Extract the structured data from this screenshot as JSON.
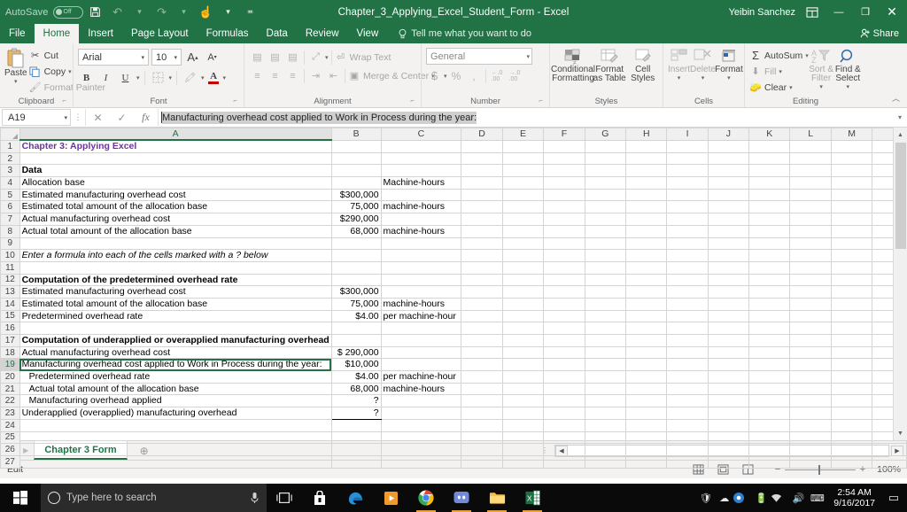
{
  "titlebar": {
    "autosave_label": "AutoSave",
    "autosave_state": "Off",
    "document_title": "Chapter_3_Applying_Excel_Student_Form  -  Excel",
    "user_name": "Yeibin Sanchez",
    "save_icon": "save-icon",
    "undo_icon": "undo-icon",
    "redo_icon": "redo-icon",
    "touch_icon": "touch-mode-icon",
    "customize_icon": "customize-quick-access-icon",
    "ribbon_display_icon": "ribbon-display-options-icon",
    "minimize_label": "—",
    "restore_label": "❐",
    "close_label": "✕"
  },
  "ribbon_tabs": [
    {
      "label": "File",
      "active": false
    },
    {
      "label": "Home",
      "active": true
    },
    {
      "label": "Insert",
      "active": false
    },
    {
      "label": "Page Layout",
      "active": false
    },
    {
      "label": "Formulas",
      "active": false
    },
    {
      "label": "Data",
      "active": false
    },
    {
      "label": "Review",
      "active": false
    },
    {
      "label": "View",
      "active": false
    }
  ],
  "tellme": {
    "label": "Tell me what you want to do",
    "icon": "lightbulb-icon"
  },
  "share": {
    "label": "Share",
    "icon": "share-person-icon"
  },
  "ribbon": {
    "clipboard": {
      "group_label": "Clipboard",
      "paste_label": "Paste",
      "cut_label": "Cut",
      "copy_label": "Copy",
      "format_painter_label": "Format Painter"
    },
    "font": {
      "group_label": "Font",
      "font_name": "Arial",
      "font_size": "10",
      "grow_label": "A",
      "shrink_label": "A",
      "bold_label": "B",
      "italic_label": "I",
      "underline_label": "U",
      "borders_icon": "borders-icon",
      "fill_color_icon": "fill-color-icon",
      "font_color_label": "A",
      "font_color_hex": "#c00000"
    },
    "alignment": {
      "group_label": "Alignment",
      "wrap_text_label": "Wrap Text",
      "merge_center_label": "Merge & Center",
      "orientation_icon": "orientation-icon",
      "decrease_indent_icon": "decrease-indent-icon",
      "increase_indent_icon": "increase-indent-icon"
    },
    "number": {
      "group_label": "Number",
      "format_value": "General",
      "currency_label": "$",
      "percent_label": "%",
      "comma_label": ",",
      "increase_decimal_label": ".00",
      "decrease_decimal_label": ".00"
    },
    "styles": {
      "group_label": "Styles",
      "conditional_formatting_label": "Conditional Formatting",
      "format_as_table_label": "Format as Table",
      "cell_styles_label": "Cell Styles"
    },
    "cells": {
      "group_label": "Cells",
      "insert_label": "Insert",
      "delete_label": "Delete",
      "format_label": "Format"
    },
    "editing": {
      "group_label": "Editing",
      "autosum_label": "AutoSum",
      "fill_label": "Fill",
      "clear_label": "Clear",
      "sort_filter_label": "Sort & Filter",
      "find_select_label": "Find & Select",
      "collapse_icon": "collapse-ribbon-icon"
    }
  },
  "formula_bar": {
    "name_box_value": "A19",
    "cancel_icon": "cancel-icon",
    "enter_icon": "enter-icon",
    "function_icon": "insert-function-icon",
    "formula_text": "Manufacturing overhead cost applied to Work in Process during the year:"
  },
  "grid": {
    "columns": [
      "A",
      "B",
      "C",
      "D",
      "E",
      "F",
      "G",
      "H",
      "I",
      "J",
      "K",
      "L",
      "M"
    ],
    "selected_column": "A",
    "selected_row": 19,
    "rows": [
      {
        "n": 1,
        "a": "Chapter 3: Applying Excel",
        "b": "",
        "c": "",
        "style": "purple"
      },
      {
        "n": 2,
        "a": "",
        "b": "",
        "c": ""
      },
      {
        "n": 3,
        "a": "Data",
        "b": "",
        "c": "",
        "style": "bold"
      },
      {
        "n": 4,
        "a": "Allocation base",
        "b": "",
        "c": "Machine-hours"
      },
      {
        "n": 5,
        "a": "Estimated manufacturing overhead cost",
        "b": "$300,000",
        "c": ""
      },
      {
        "n": 6,
        "a": "Estimated total amount of the allocation base",
        "b": "75,000",
        "c": "machine-hours"
      },
      {
        "n": 7,
        "a": "Actual manufacturing overhead cost",
        "b": "$290,000",
        "c": ""
      },
      {
        "n": 8,
        "a": "Actual total amount of the allocation base",
        "b": "68,000",
        "c": "machine-hours"
      },
      {
        "n": 9,
        "a": "",
        "b": "",
        "c": ""
      },
      {
        "n": 10,
        "a": "Enter a formula into each of the cells marked with a ? below",
        "b": "",
        "c": "",
        "style": "italic"
      },
      {
        "n": 11,
        "a": "",
        "b": "",
        "c": ""
      },
      {
        "n": 12,
        "a": "Computation of the predetermined overhead rate",
        "b": "",
        "c": "",
        "style": "bold"
      },
      {
        "n": 13,
        "a": "Estimated manufacturing overhead cost",
        "b": "$300,000",
        "c": ""
      },
      {
        "n": 14,
        "a": "Estimated total amount of the allocation base",
        "b": "75,000",
        "c": "machine-hours"
      },
      {
        "n": 15,
        "a": "Predetermined overhead rate",
        "b": "$4.00",
        "c": "per machine-hour"
      },
      {
        "n": 16,
        "a": "",
        "b": "",
        "c": ""
      },
      {
        "n": 17,
        "a": "Computation of underapplied or overapplied manufacturing overhead",
        "b": "",
        "c": "",
        "style": "bold"
      },
      {
        "n": 18,
        "a": "Actual manufacturing overhead cost",
        "b": "$  290,000",
        "c": "",
        "b_border": "top"
      },
      {
        "n": 19,
        "a": "Manufacturing overhead cost applied to Work in Process during the year:",
        "b": "$10,000",
        "c": "",
        "selected": true
      },
      {
        "n": 20,
        "a": "Predetermined overhead rate",
        "b": "$4.00",
        "c": "per machine-hour",
        "indent": true
      },
      {
        "n": 21,
        "a": "Actual total amount of the allocation base",
        "b": "68,000",
        "c": "machine-hours",
        "indent": true
      },
      {
        "n": 22,
        "a": "Manufacturing overhead applied",
        "b": "?",
        "c": "",
        "indent": true,
        "b_border": "top"
      },
      {
        "n": 23,
        "a": "Underapplied (overapplied) manufacturing overhead",
        "b": "?",
        "c": "",
        "b_border": "topbot"
      },
      {
        "n": 24,
        "a": "",
        "b": "",
        "c": ""
      },
      {
        "n": 25,
        "a": "",
        "b": "",
        "c": ""
      },
      {
        "n": 26,
        "a": "",
        "b": "",
        "c": ""
      },
      {
        "n": 27,
        "a": "",
        "b": "",
        "c": ""
      }
    ]
  },
  "sheet_tabs": {
    "prev_icon": "previous-sheet-icon",
    "next_icon": "next-sheet-icon",
    "tabs": [
      {
        "label": "Chapter 3 Form",
        "active": true
      }
    ],
    "add_sheet_label": "⊕"
  },
  "status_bar": {
    "mode": "Edit",
    "normal_view_icon": "normal-view-icon",
    "page_layout_icon": "page-layout-view-icon",
    "page_break_icon": "page-break-preview-icon",
    "zoom_out_label": "−",
    "zoom_in_label": "+",
    "zoom_value": "100%"
  },
  "taskbar": {
    "start_icon": "windows-start-icon",
    "search_placeholder": "Type here to search",
    "mic_icon": "microphone-icon",
    "task_view_icon": "task-view-icon",
    "apps": [
      {
        "name": "store-icon",
        "running": false
      },
      {
        "name": "edge-icon",
        "running": false
      },
      {
        "name": "movies-tv-icon",
        "running": false
      },
      {
        "name": "chrome-icon",
        "running": true
      },
      {
        "name": "discord-icon",
        "running": true
      },
      {
        "name": "file-explorer-icon",
        "running": true
      },
      {
        "name": "excel-icon",
        "running": true
      }
    ],
    "tray": [
      "security-icon",
      "onedrive-icon",
      "chrome-tray-icon",
      "battery-icon",
      "wifi-icon",
      "volume-icon",
      "keyboard-icon"
    ],
    "time": "2:54 AM",
    "date": "9/16/2017",
    "action_center_icon": "action-center-icon"
  }
}
